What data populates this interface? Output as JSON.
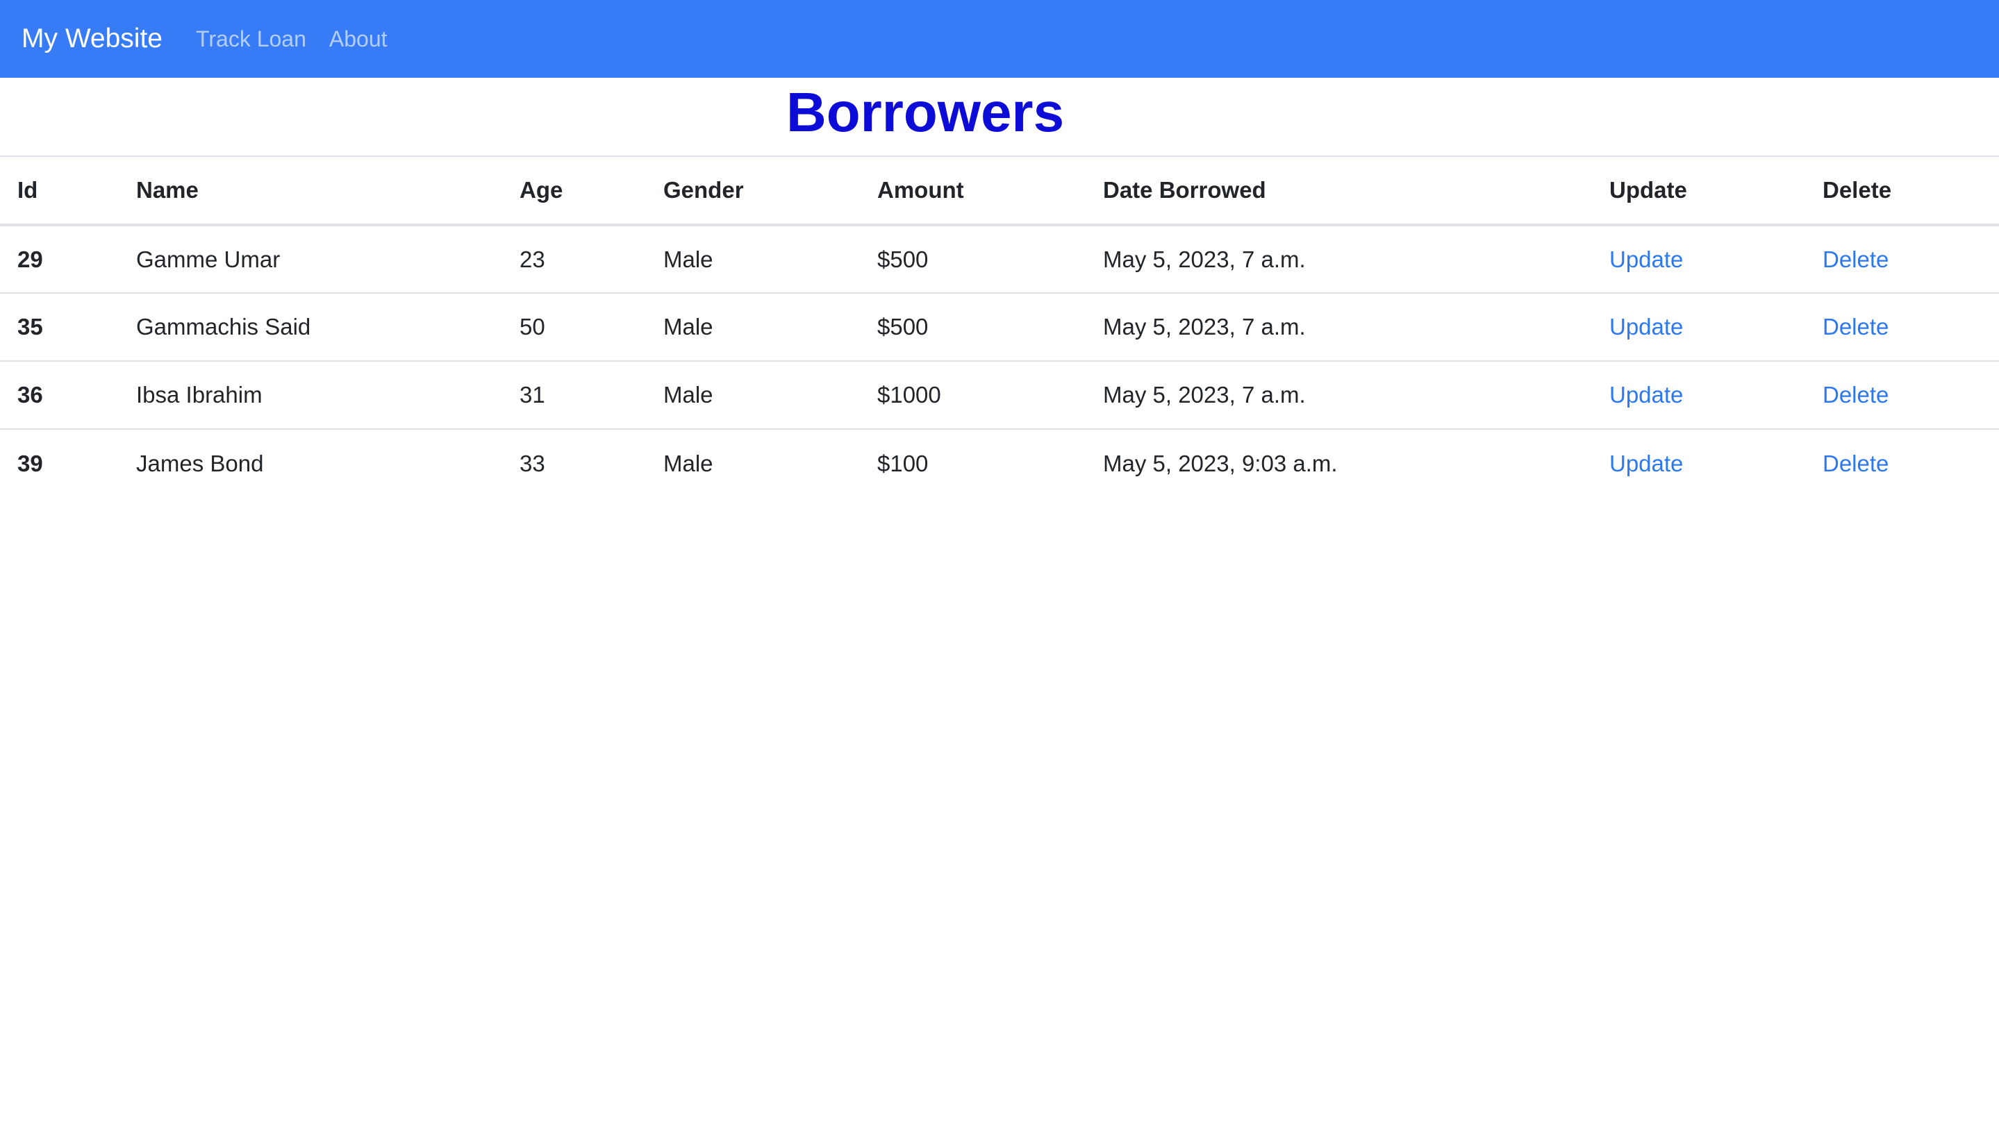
{
  "navbar": {
    "brand": "My Website",
    "links": [
      "Track Loan",
      "About"
    ]
  },
  "page": {
    "title": "Borrowers"
  },
  "colors": {
    "navbar_bg": "#377cf6",
    "title": "#0d0bd6",
    "link": "#2b78f0"
  },
  "table": {
    "headers": [
      "Id",
      "Name",
      "Age",
      "Gender",
      "Amount",
      "Date Borrowed",
      "Update",
      "Delete"
    ],
    "rows": [
      {
        "id": "29",
        "name": "Gamme Umar",
        "age": "23",
        "gender": "Male",
        "amount": "$500",
        "date": "May 5, 2023, 7 a.m.",
        "update": "Update",
        "delete": "Delete"
      },
      {
        "id": "35",
        "name": "Gammachis Said",
        "age": "50",
        "gender": "Male",
        "amount": "$500",
        "date": "May 5, 2023, 7 a.m.",
        "update": "Update",
        "delete": "Delete"
      },
      {
        "id": "36",
        "name": "Ibsa Ibrahim",
        "age": "31",
        "gender": "Male",
        "amount": "$1000",
        "date": "May 5, 2023, 7 a.m.",
        "update": "Update",
        "delete": "Delete"
      },
      {
        "id": "39",
        "name": "James Bond",
        "age": "33",
        "gender": "Male",
        "amount": "$100",
        "date": "May 5, 2023, 9:03 a.m.",
        "update": "Update",
        "delete": "Delete"
      }
    ]
  }
}
